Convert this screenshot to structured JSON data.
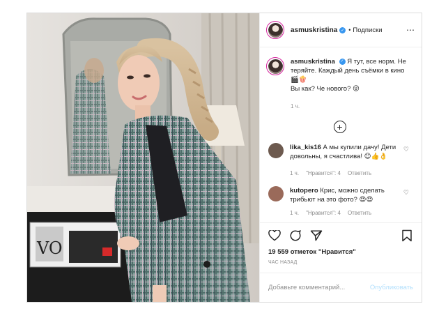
{
  "header": {
    "username": "asmuskristina",
    "separator": "•",
    "follow_label": "Подписки",
    "more_icon": "ellipsis-icon"
  },
  "caption": {
    "username": "asmuskristina",
    "text_line1": "Я тут, все норм. Не теряйте. Каждый день съёмки в кино 🎬🍿",
    "text_line2": "Вы как? Че нового? 😜",
    "time": "1 ч."
  },
  "comments": [
    {
      "username": "lika_kis16",
      "text": "А мы купили дачу! Дети довольны, я счастлива! 😊👍👌",
      "time": "1 ч.",
      "likes": "\"Нравится\": 4",
      "reply": "Ответить",
      "avatar_color": "#6d5a4f"
    },
    {
      "username": "kutopero",
      "text": "Крис, можно сделать трибьют на это фото? 😍😍",
      "time": "1 ч.",
      "likes": "\"Нравится\": 4",
      "reply": "Ответить",
      "avatar_color": "#9a6a5a"
    }
  ],
  "footer": {
    "likes_text": "19 559 отметок \"Нравится\"",
    "time_ago": "ЧАС НАЗАД",
    "comment_placeholder": "Добавьте комментарий...",
    "publish_label": "Опубликовать"
  },
  "colors": {
    "verified": "#3897f0",
    "publish_disabled": "#b2dffc",
    "meta_gray": "#8e8e8e"
  }
}
